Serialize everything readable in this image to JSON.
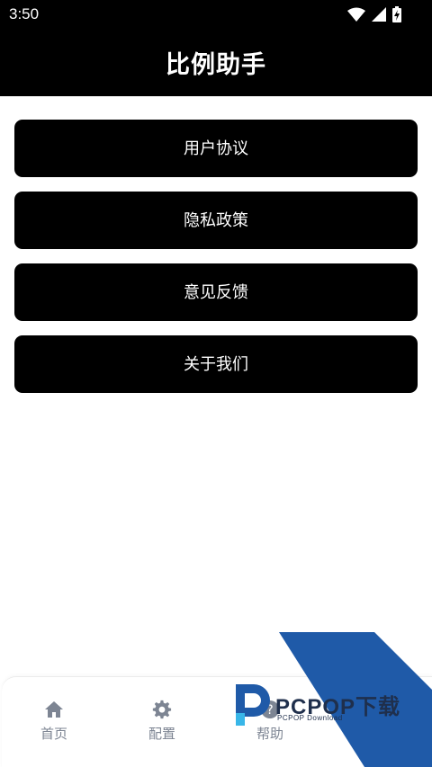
{
  "status_bar": {
    "time": "3:50",
    "icons": [
      "wifi-icon",
      "cellular-signal-icon",
      "battery-charging-icon"
    ]
  },
  "app_bar": {
    "title": "比例助手"
  },
  "menu": {
    "items": [
      {
        "label": "用户协议"
      },
      {
        "label": "隐私政策"
      },
      {
        "label": "意见反馈"
      },
      {
        "label": "关于我们"
      }
    ]
  },
  "bottom_nav": {
    "items": [
      {
        "label": "首页",
        "icon": "home-icon"
      },
      {
        "label": "配置",
        "icon": "gear-icon"
      },
      {
        "label": "帮助",
        "icon": "help-icon"
      }
    ],
    "color": "#7d8593"
  },
  "watermark": {
    "logo_text": "PCPOP下载",
    "sub_text": "PCPOP Download",
    "accent": "#1f5aa8"
  },
  "colors": {
    "header_bg": "#000000",
    "button_bg": "#000000",
    "button_text": "#ffffff",
    "page_bg": "#ffffff"
  }
}
